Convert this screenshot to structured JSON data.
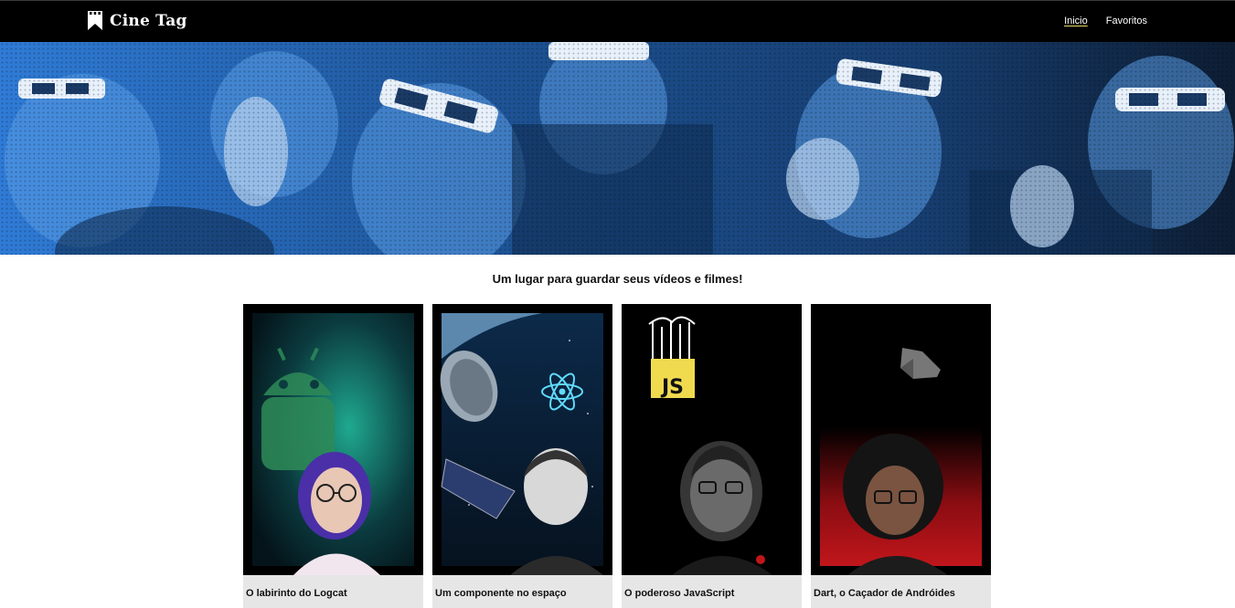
{
  "brand": {
    "name": "Cine Tag",
    "logo_icon": "bookmark-clapper-icon"
  },
  "nav": {
    "items": [
      {
        "label": "Inicio",
        "active": true
      },
      {
        "label": "Favoritos",
        "active": false
      }
    ]
  },
  "banner": {
    "image": "audience-3d-glasses-photo",
    "tint": "#2f7bd6"
  },
  "tagline": "Um lugar para guardar seus vídeos e filmes!",
  "cards": [
    {
      "title": "O labirinto do Logcat",
      "thumb": "android-logcat-thumbnail",
      "accent": "#1fa98f"
    },
    {
      "title": "Um componente no espaço",
      "thumb": "react-space-thumbnail",
      "accent": "#61dafb"
    },
    {
      "title": "O poderoso JavaScript",
      "thumb": "javascript-thumbnail",
      "accent": "#f0db4f"
    },
    {
      "title": "Dart, o Caçador de Andróides",
      "thumb": "dart-thumbnail",
      "accent": "#c0161b"
    }
  ]
}
